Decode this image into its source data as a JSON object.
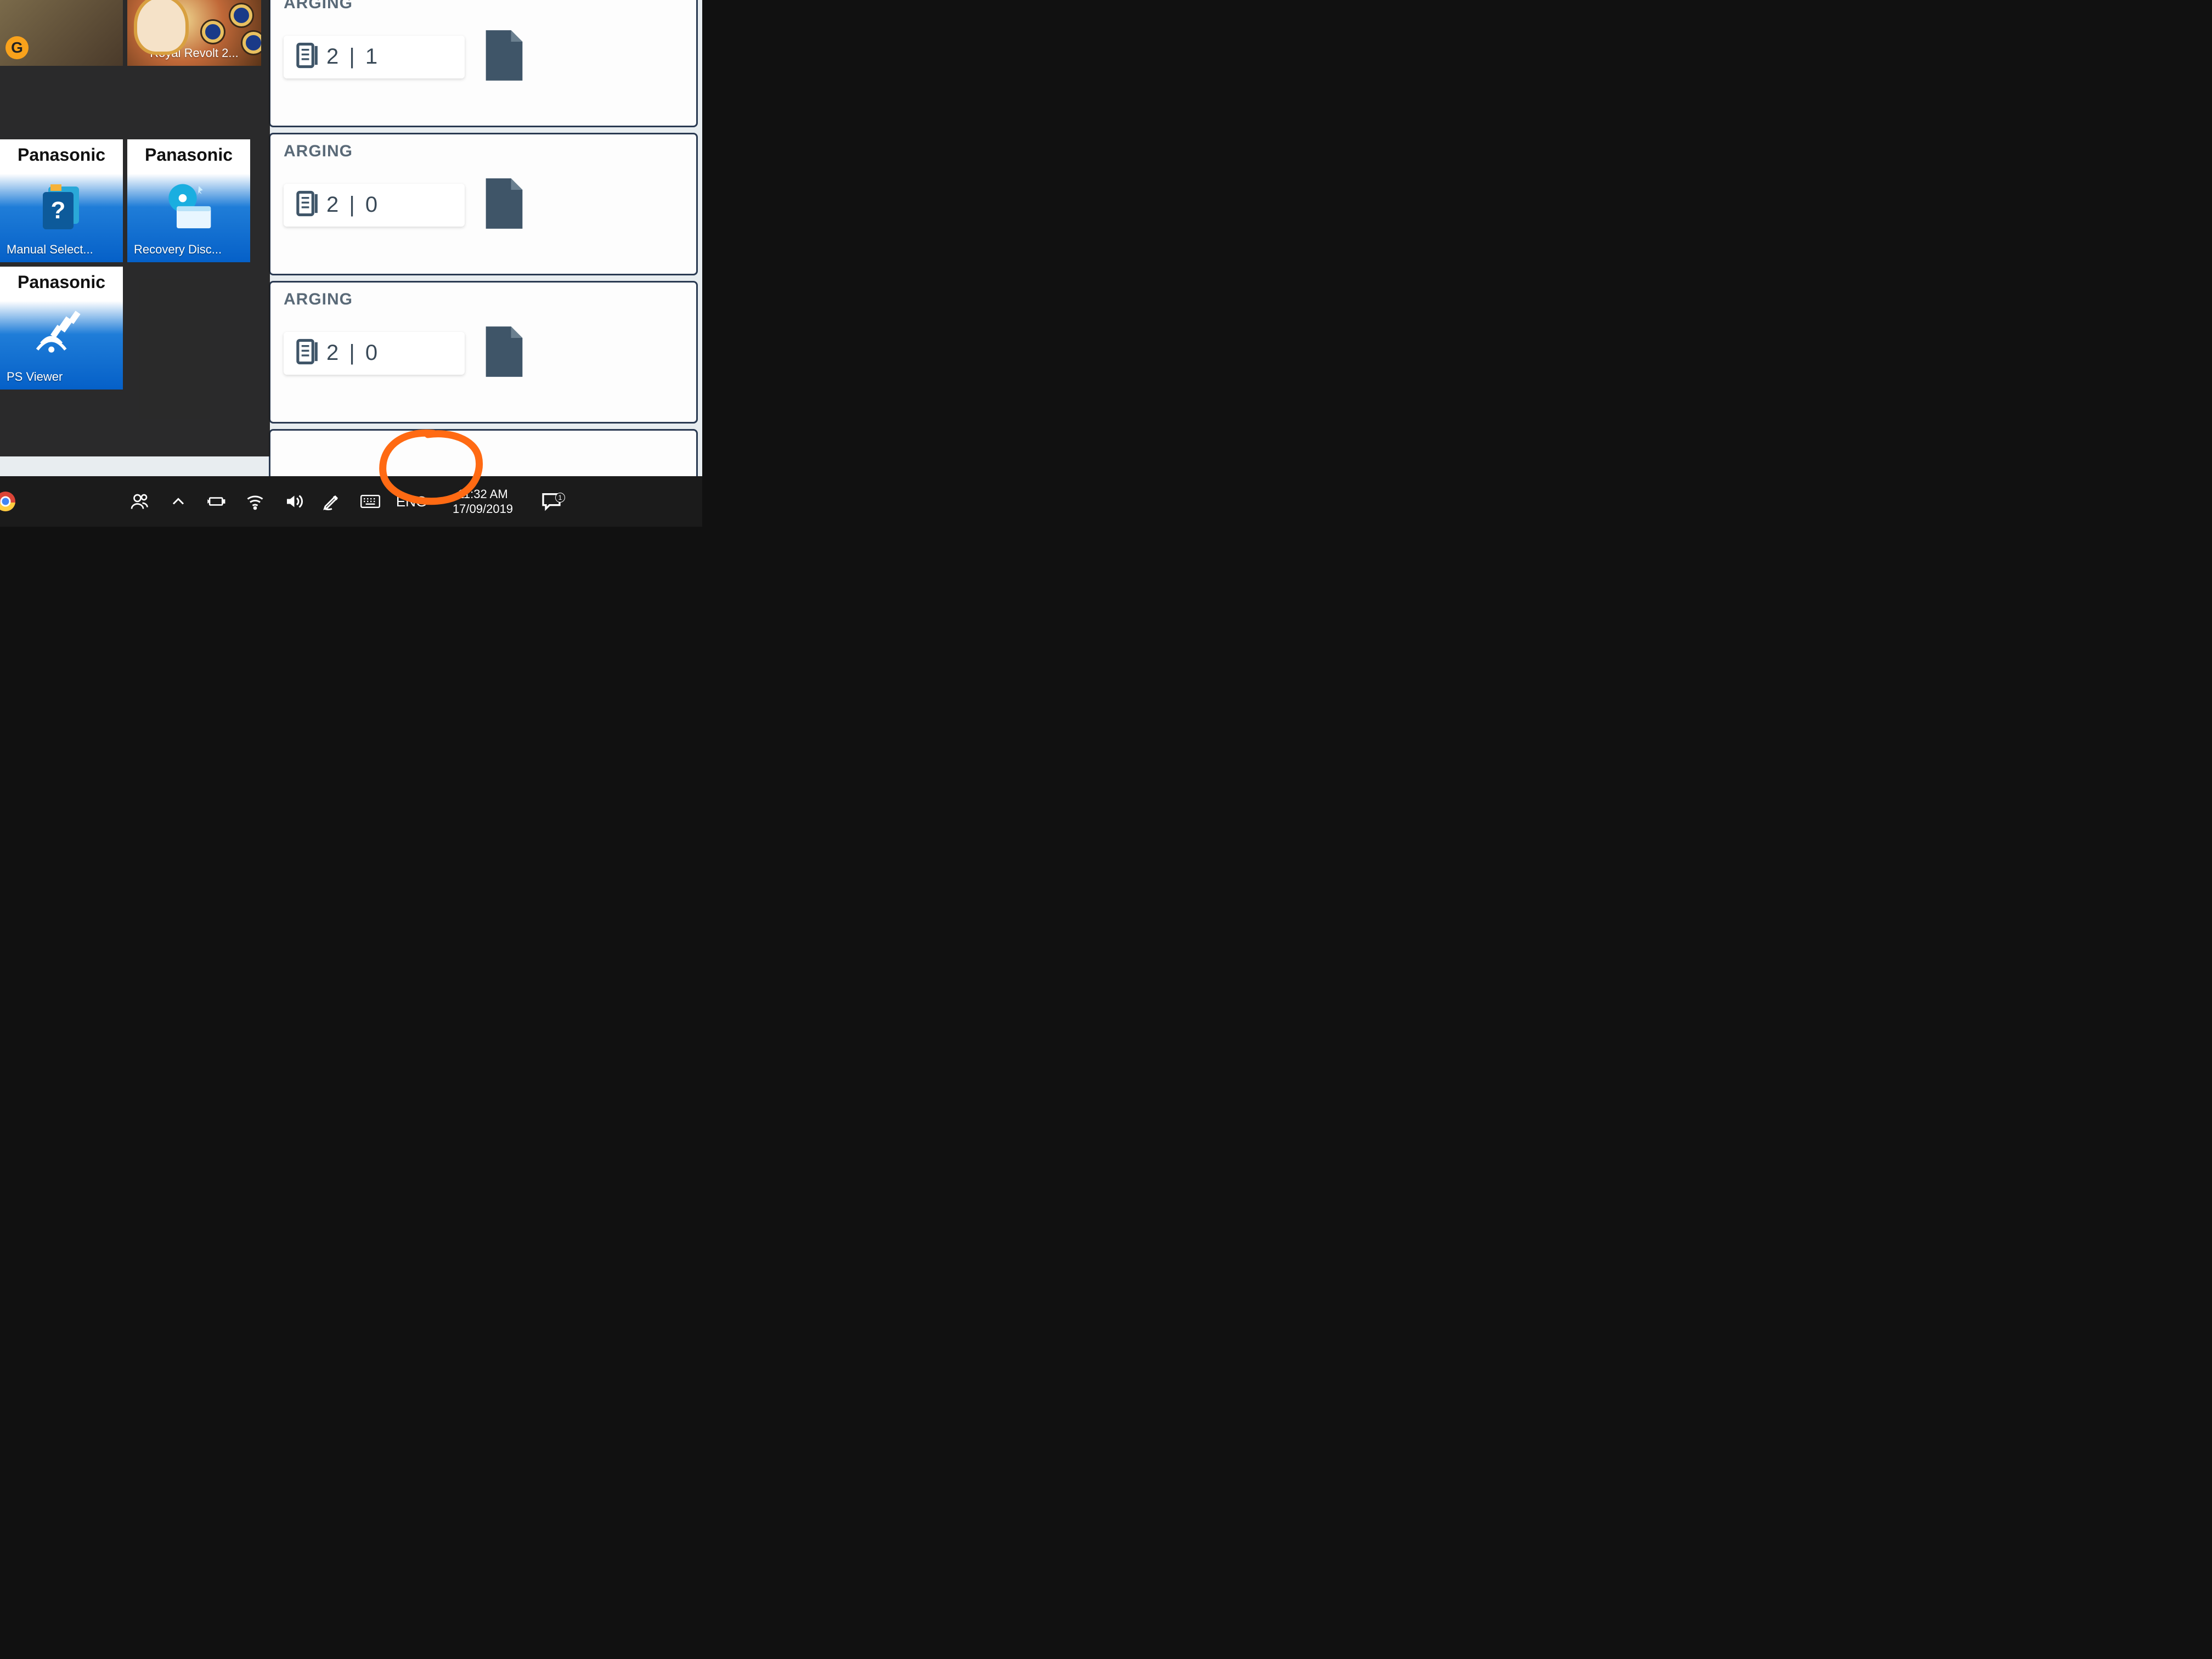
{
  "start_menu": {
    "tiles": {
      "game1": {
        "title": ""
      },
      "game2": {
        "title": "Royal Revolt 2...",
        "publisher_badge": "G"
      },
      "panasonic_brand": "Panasonic",
      "pan1": {
        "title": "Manual Select..."
      },
      "pan2": {
        "title": "Recovery Disc..."
      },
      "pan3": {
        "title": "PS Viewer"
      }
    }
  },
  "background_app": {
    "panel_label_fragment": "ARGING",
    "rows": [
      {
        "value": "2 | 1"
      },
      {
        "value": "2 | 0"
      },
      {
        "value": "2 | 0"
      }
    ]
  },
  "taskbar": {
    "language": "ENG",
    "time": "11:32 AM",
    "date": "17/09/2019",
    "notification_count": "1"
  }
}
